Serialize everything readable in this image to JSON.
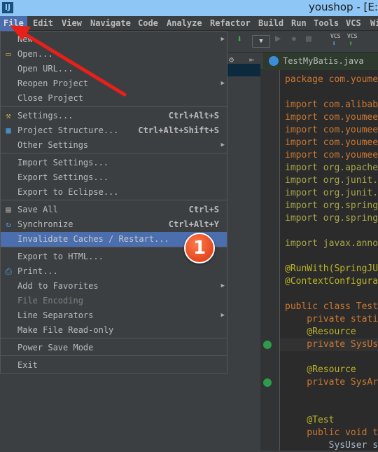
{
  "window": {
    "title": "youshop - [E:\\",
    "app_icon": "intellij-logo"
  },
  "menubar": [
    "File",
    "Edit",
    "View",
    "Navigate",
    "Code",
    "Analyze",
    "Refactor",
    "Build",
    "Run",
    "Tools",
    "VCS",
    "Wi"
  ],
  "toolbar": {
    "vcs1": "VCS",
    "vcs2": "VCS"
  },
  "tab": {
    "label": "TestMyBatis.java"
  },
  "file_menu": [
    {
      "label": "New",
      "submenu": true
    },
    {
      "label": "Open...",
      "icon": "folder-icon"
    },
    {
      "label": "Open URL..."
    },
    {
      "label": "Reopen Project",
      "submenu": true
    },
    {
      "label": "Close Project"
    },
    {
      "label": "Settings...",
      "icon": "wrench-icon",
      "shortcut": "Ctrl+Alt+S"
    },
    {
      "label": "Project Structure...",
      "icon": "project-structure-icon",
      "shortcut": "Ctrl+Alt+Shift+S"
    },
    {
      "label": "Other Settings",
      "submenu": true
    },
    {
      "label": "Import Settings..."
    },
    {
      "label": "Export Settings..."
    },
    {
      "label": "Export to Eclipse..."
    },
    {
      "label": "Save All",
      "icon": "save-icon",
      "shortcut": "Ctrl+S"
    },
    {
      "label": "Synchronize",
      "icon": "sync-icon",
      "shortcut": "Ctrl+Alt+Y"
    },
    {
      "label": "Invalidate Caches / Restart...",
      "highlighted": true
    },
    {
      "label": "Export to HTML..."
    },
    {
      "label": "Print...",
      "icon": "printer-icon"
    },
    {
      "label": "Add to Favorites",
      "submenu": true
    },
    {
      "label": "File Encoding",
      "disabled": true
    },
    {
      "label": "Line Separators",
      "submenu": true
    },
    {
      "label": "Make File Read-only"
    },
    {
      "label": "Power Save Mode"
    },
    {
      "label": "Exit"
    }
  ],
  "annotation": {
    "badge": "1",
    "arrow_color": "#e8201a"
  },
  "code": [
    "package com.youme",
    "",
    "import com.alibab",
    "import com.youmee",
    "import com.youmee",
    "import com.youmee",
    "import com.youmee",
    "import org.apache",
    "import org.junit.",
    "import org.junit.",
    "import org.spring",
    "import org.spring",
    "",
    "import javax.anno",
    "",
    "@RunWith(SpringJU",
    "@ContextConfigura",
    "",
    "public class Test",
    "    private stati",
    "    @Resource",
    "    private SysUs",
    "",
    "    @Resource",
    "    private SysAr",
    "",
    "",
    "    @Test",
    "    public void t",
    "        SysUser s"
  ],
  "colors": {
    "menu_bg": "#3c3f41",
    "highlight": "#4b6eaf",
    "editor_bg": "#2b2b2b",
    "keyword": "#cc7832",
    "annotation": "#bbb529"
  }
}
